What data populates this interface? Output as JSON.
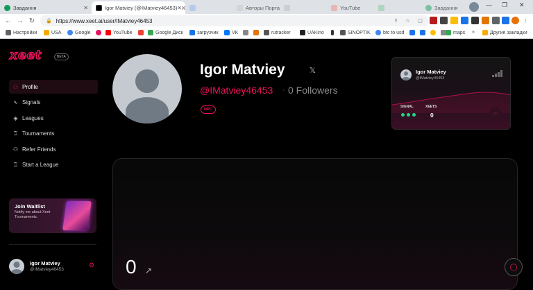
{
  "browser": {
    "tabs": [
      {
        "title": "Завдання",
        "active": false
      },
      {
        "title": "Igor Matviey (@IMatviey46453) - X",
        "active": true
      },
      {
        "title": "",
        "active": false
      },
      {
        "title": "Авторы Портал",
        "active": false
      },
      {
        "title": "",
        "active": false
      },
      {
        "title": "YouTube",
        "active": false
      },
      {
        "title": "",
        "active": false
      },
      {
        "title": "Завдання",
        "active": false
      }
    ],
    "url": "https://www.xeet.ai/user/IMatviey46453",
    "bookmarks": [
      "Настройки",
      "USA",
      "Google",
      "",
      "YouTube",
      "Gmail",
      "Google Диск",
      "загрузчик",
      "VK",
      "",
      "",
      "rutracker",
      "UAKino",
      "",
      "SINOPTIK",
      "btc to usd",
      "",
      "",
      "",
      "",
      "maps",
      "»",
      "Другие закладки"
    ]
  },
  "sidebar": {
    "logo": "xeet",
    "beta": "BETA",
    "items": [
      {
        "label": "Profile",
        "icon": "user-icon",
        "active": true
      },
      {
        "label": "Signals",
        "icon": "pulse-icon",
        "active": false
      },
      {
        "label": "Leagues",
        "icon": "layers-icon",
        "active": false
      },
      {
        "label": "Tournaments",
        "icon": "trophy-icon",
        "active": false
      },
      {
        "label": "Refer Friends",
        "icon": "users-icon",
        "active": false
      },
      {
        "label": "Start a League",
        "icon": "trophy-icon",
        "active": false
      }
    ],
    "waitlist": {
      "title": "Join Waitlist",
      "subtitle": "Notify me about Xeet Tournaments."
    },
    "user": {
      "name": "Igor Matviey",
      "handle": "@IMatviey46453"
    }
  },
  "profile": {
    "name": "Igor Matviey",
    "handle": "@IMatviey46453",
    "separator": "·",
    "followers": "0 Followers",
    "badge": "NPC"
  },
  "card": {
    "name": "Igor Matviey",
    "handle": "@IMatviey46453",
    "signal_label": "SIGNAL",
    "xeets_label": "XEETS",
    "xeets_value": "0",
    "signal_level": 3,
    "accent": "#e8125c",
    "signal_color": "#1ed88c"
  },
  "main": {
    "score": "0"
  },
  "colors": {
    "accent": "#e8125c",
    "background": "#000000"
  }
}
